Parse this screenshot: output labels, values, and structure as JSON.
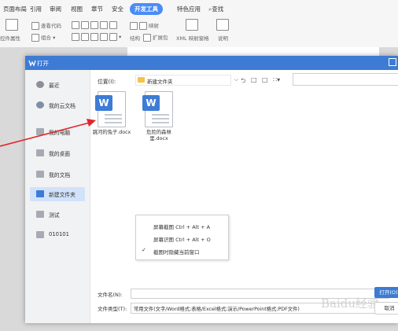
{
  "ribbon": {
    "tabs": [
      "页面布局",
      "引用",
      "审阅",
      "视图",
      "章节",
      "安全",
      "开发工具",
      "特色应用",
      "查找"
    ],
    "active_tab": "开发工具",
    "tools": {
      "view_code": "查看代码",
      "control_props": "控件属性",
      "combine": "组合",
      "structure": "结构",
      "expand_pkg": "扩展包",
      "xml_mapping": "XML 映射窗格",
      "caption": "说明",
      "map": "映射"
    }
  },
  "dialog": {
    "title": "打开",
    "sidebar": [
      {
        "label": "最近"
      },
      {
        "label": "我的云文档"
      },
      {
        "label": "我的电脑"
      },
      {
        "label": "我的桌面"
      },
      {
        "label": "我的文档"
      },
      {
        "label": "新建文件夹"
      },
      {
        "label": "测试"
      },
      {
        "label": "010101"
      }
    ],
    "selected_sidebar": "新建文件夹",
    "location_label": "位置(I):",
    "location_value": "新建文件夹",
    "files": [
      {
        "name": "跳河的兔子.docx",
        "icon": "word-doc-icon"
      },
      {
        "name": "危险的森林里.docx",
        "icon": "word-doc-icon"
      }
    ],
    "context_menu": [
      {
        "label": "屏幕截图 Ctrl + Alt + A",
        "checked": false
      },
      {
        "label": "屏幕识图 Ctrl + Alt + O",
        "checked": false
      },
      {
        "label": "截图时隐藏当前窗口",
        "checked": true
      }
    ],
    "filename_label": "文件名(N):",
    "filename_value": "",
    "filetype_label": "文件类型(T):",
    "filetype_value": "常用文件(文字/Word格式;表格/Excel格式;演示/PowerPoint格式;PDF文件)",
    "open_button": "打开(O)",
    "cancel_button": "取消",
    "watermark": "Baidu经验"
  },
  "colors": {
    "accent": "#3d7bd5",
    "active_tab": "#4a8cf7",
    "arrow": "#e0262b"
  }
}
